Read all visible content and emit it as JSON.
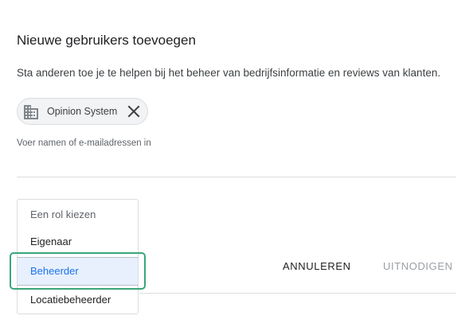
{
  "dialog": {
    "title": "Nieuwe gebruikers toevoegen",
    "subtitle": "Sta anderen toe je te helpen bij het beheer van bedrijfsinformatie en reviews van klanten."
  },
  "chip": {
    "label": "Opinion System",
    "icon": "building-icon",
    "close_icon": "close-icon"
  },
  "input": {
    "placeholder": "Voer namen of e-mailadressen in"
  },
  "role_menu": {
    "header": "Een rol kiezen",
    "options": [
      "Eigenaar",
      "Beheerder",
      "Locatiebeheerder"
    ],
    "selected": "Beheerder"
  },
  "actions": {
    "cancel_label": "ANNULEREN",
    "invite_label": "UITNODIGEN"
  },
  "colors": {
    "accent": "#1a73e8",
    "selected_bg": "#e8f0fe",
    "focus_ring": "#3aa57a",
    "disabled_text": "#9aa0a6"
  }
}
